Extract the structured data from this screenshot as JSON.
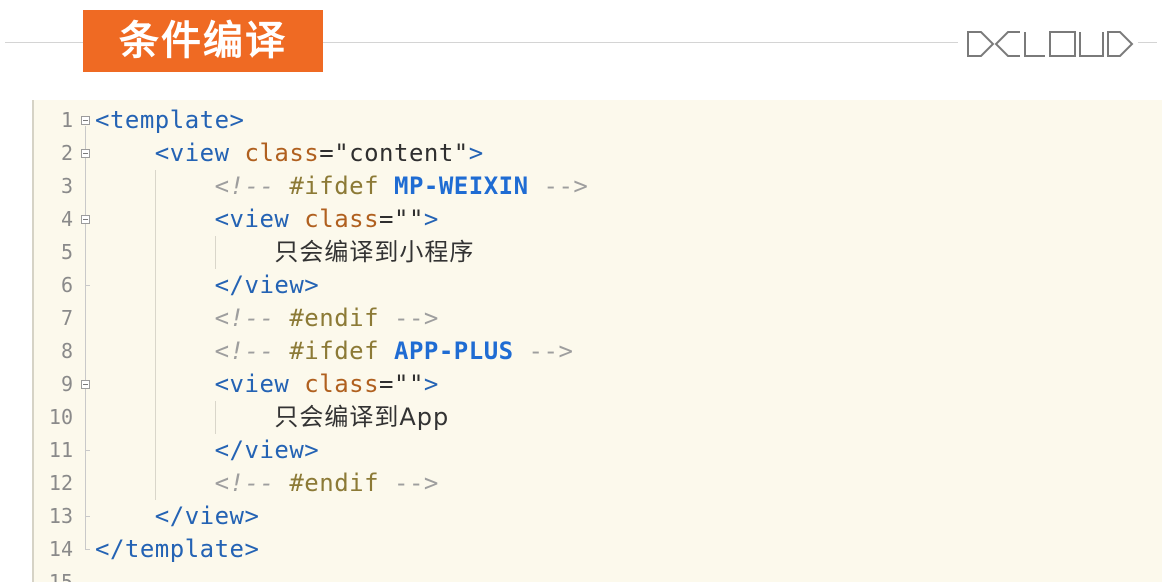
{
  "header": {
    "title": "条件编译"
  },
  "logo": {
    "text": "DCLOUD"
  },
  "theme": {
    "title_bg": "#EF6A23",
    "editor_bg": "#FCF9EC",
    "logo_stroke": "#7A7A7A"
  },
  "editor": {
    "lines": [
      {
        "number": "1",
        "foldable": true,
        "tokens": [
          {
            "text": "<template>",
            "color": "#2463B4"
          }
        ]
      },
      {
        "number": "2",
        "foldable": true,
        "tokens": [
          {
            "text": "    "
          },
          {
            "text": "<view",
            "color": "#2463B4"
          },
          {
            "text": " "
          },
          {
            "text": "class",
            "color": "#B0601F"
          },
          {
            "text": "=\"content\"",
            "color": "#2F2F2F"
          },
          {
            "text": ">",
            "color": "#2463B4"
          }
        ]
      },
      {
        "number": "3",
        "foldable": false,
        "tokens": [
          {
            "text": "        "
          },
          {
            "text": "<!--",
            "color": "#9E9E9E",
            "italic": true
          },
          {
            "text": " "
          },
          {
            "text": "#ifdef",
            "color": "#8C7A36"
          },
          {
            "text": " "
          },
          {
            "text": "MP-WEIXIN",
            "color": "#1F6CD3",
            "bold": true
          },
          {
            "text": " "
          },
          {
            "text": "-->",
            "color": "#9E9E9E"
          }
        ]
      },
      {
        "number": "4",
        "foldable": true,
        "tokens": [
          {
            "text": "        "
          },
          {
            "text": "<view",
            "color": "#2463B4"
          },
          {
            "text": " "
          },
          {
            "text": "class",
            "color": "#B0601F"
          },
          {
            "text": "=\"\"",
            "color": "#2F2F2F"
          },
          {
            "text": ">",
            "color": "#2463B4"
          }
        ]
      },
      {
        "number": "5",
        "foldable": false,
        "tokens": [
          {
            "text": "            "
          },
          {
            "text": "只会编译到小程序",
            "color": "#333333",
            "proportional": true
          }
        ]
      },
      {
        "number": "6",
        "foldable": false,
        "tokens": [
          {
            "text": "        "
          },
          {
            "text": "</view>",
            "color": "#2463B4"
          }
        ]
      },
      {
        "number": "7",
        "foldable": false,
        "tokens": [
          {
            "text": "        "
          },
          {
            "text": "<!--",
            "color": "#9E9E9E",
            "italic": true
          },
          {
            "text": " "
          },
          {
            "text": "#endif",
            "color": "#8C7A36"
          },
          {
            "text": " "
          },
          {
            "text": "-->",
            "color": "#9E9E9E"
          }
        ]
      },
      {
        "number": "8",
        "foldable": false,
        "tokens": [
          {
            "text": "        "
          },
          {
            "text": "<!--",
            "color": "#9E9E9E",
            "italic": true
          },
          {
            "text": " "
          },
          {
            "text": "#ifdef",
            "color": "#8C7A36"
          },
          {
            "text": " "
          },
          {
            "text": "APP-PLUS",
            "color": "#1F6CD3",
            "bold": true
          },
          {
            "text": " "
          },
          {
            "text": "-->",
            "color": "#9E9E9E"
          }
        ]
      },
      {
        "number": "9",
        "foldable": true,
        "tokens": [
          {
            "text": "        "
          },
          {
            "text": "<view",
            "color": "#2463B4"
          },
          {
            "text": " "
          },
          {
            "text": "class",
            "color": "#B0601F"
          },
          {
            "text": "=\"\"",
            "color": "#2F2F2F"
          },
          {
            "text": ">",
            "color": "#2463B4"
          }
        ]
      },
      {
        "number": "10",
        "foldable": false,
        "tokens": [
          {
            "text": "            "
          },
          {
            "text": "只会编译到App",
            "color": "#333333",
            "proportional": true
          }
        ]
      },
      {
        "number": "11",
        "foldable": false,
        "tokens": [
          {
            "text": "        "
          },
          {
            "text": "</view>",
            "color": "#2463B4"
          }
        ]
      },
      {
        "number": "12",
        "foldable": false,
        "tokens": [
          {
            "text": "        "
          },
          {
            "text": "<!--",
            "color": "#9E9E9E",
            "italic": true
          },
          {
            "text": " "
          },
          {
            "text": "#endif",
            "color": "#8C7A36"
          },
          {
            "text": " "
          },
          {
            "text": "-->",
            "color": "#9E9E9E"
          }
        ]
      },
      {
        "number": "13",
        "foldable": false,
        "tokens": [
          {
            "text": "    "
          },
          {
            "text": "</view>",
            "color": "#2463B4"
          }
        ]
      },
      {
        "number": "14",
        "foldable": false,
        "tokens": [
          {
            "text": "</template>",
            "color": "#2463B4"
          }
        ]
      },
      {
        "number": "15",
        "foldable": false,
        "tokens": []
      }
    ]
  }
}
